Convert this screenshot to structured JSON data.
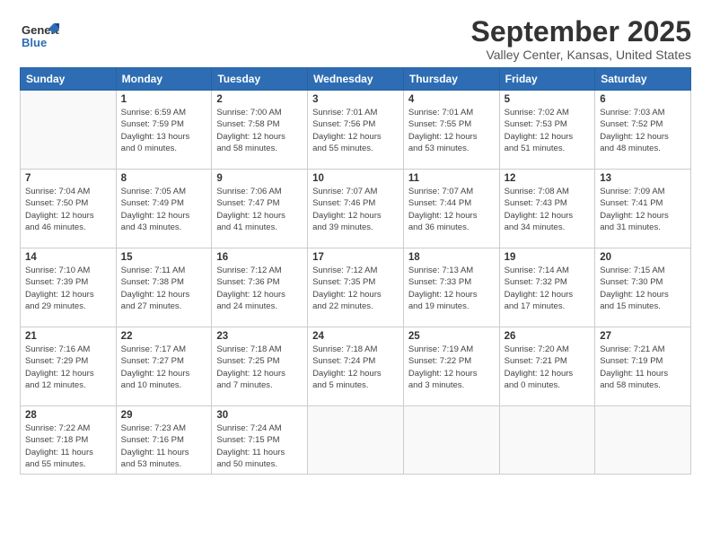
{
  "logo": {
    "general": "General",
    "blue": "Blue"
  },
  "title": "September 2025",
  "subtitle": "Valley Center, Kansas, United States",
  "days_of_week": [
    "Sunday",
    "Monday",
    "Tuesday",
    "Wednesday",
    "Thursday",
    "Friday",
    "Saturday"
  ],
  "weeks": [
    [
      {
        "day": "",
        "info": ""
      },
      {
        "day": "1",
        "info": "Sunrise: 6:59 AM\nSunset: 7:59 PM\nDaylight: 13 hours\nand 0 minutes."
      },
      {
        "day": "2",
        "info": "Sunrise: 7:00 AM\nSunset: 7:58 PM\nDaylight: 12 hours\nand 58 minutes."
      },
      {
        "day": "3",
        "info": "Sunrise: 7:01 AM\nSunset: 7:56 PM\nDaylight: 12 hours\nand 55 minutes."
      },
      {
        "day": "4",
        "info": "Sunrise: 7:01 AM\nSunset: 7:55 PM\nDaylight: 12 hours\nand 53 minutes."
      },
      {
        "day": "5",
        "info": "Sunrise: 7:02 AM\nSunset: 7:53 PM\nDaylight: 12 hours\nand 51 minutes."
      },
      {
        "day": "6",
        "info": "Sunrise: 7:03 AM\nSunset: 7:52 PM\nDaylight: 12 hours\nand 48 minutes."
      }
    ],
    [
      {
        "day": "7",
        "info": "Sunrise: 7:04 AM\nSunset: 7:50 PM\nDaylight: 12 hours\nand 46 minutes."
      },
      {
        "day": "8",
        "info": "Sunrise: 7:05 AM\nSunset: 7:49 PM\nDaylight: 12 hours\nand 43 minutes."
      },
      {
        "day": "9",
        "info": "Sunrise: 7:06 AM\nSunset: 7:47 PM\nDaylight: 12 hours\nand 41 minutes."
      },
      {
        "day": "10",
        "info": "Sunrise: 7:07 AM\nSunset: 7:46 PM\nDaylight: 12 hours\nand 39 minutes."
      },
      {
        "day": "11",
        "info": "Sunrise: 7:07 AM\nSunset: 7:44 PM\nDaylight: 12 hours\nand 36 minutes."
      },
      {
        "day": "12",
        "info": "Sunrise: 7:08 AM\nSunset: 7:43 PM\nDaylight: 12 hours\nand 34 minutes."
      },
      {
        "day": "13",
        "info": "Sunrise: 7:09 AM\nSunset: 7:41 PM\nDaylight: 12 hours\nand 31 minutes."
      }
    ],
    [
      {
        "day": "14",
        "info": "Sunrise: 7:10 AM\nSunset: 7:39 PM\nDaylight: 12 hours\nand 29 minutes."
      },
      {
        "day": "15",
        "info": "Sunrise: 7:11 AM\nSunset: 7:38 PM\nDaylight: 12 hours\nand 27 minutes."
      },
      {
        "day": "16",
        "info": "Sunrise: 7:12 AM\nSunset: 7:36 PM\nDaylight: 12 hours\nand 24 minutes."
      },
      {
        "day": "17",
        "info": "Sunrise: 7:12 AM\nSunset: 7:35 PM\nDaylight: 12 hours\nand 22 minutes."
      },
      {
        "day": "18",
        "info": "Sunrise: 7:13 AM\nSunset: 7:33 PM\nDaylight: 12 hours\nand 19 minutes."
      },
      {
        "day": "19",
        "info": "Sunrise: 7:14 AM\nSunset: 7:32 PM\nDaylight: 12 hours\nand 17 minutes."
      },
      {
        "day": "20",
        "info": "Sunrise: 7:15 AM\nSunset: 7:30 PM\nDaylight: 12 hours\nand 15 minutes."
      }
    ],
    [
      {
        "day": "21",
        "info": "Sunrise: 7:16 AM\nSunset: 7:29 PM\nDaylight: 12 hours\nand 12 minutes."
      },
      {
        "day": "22",
        "info": "Sunrise: 7:17 AM\nSunset: 7:27 PM\nDaylight: 12 hours\nand 10 minutes."
      },
      {
        "day": "23",
        "info": "Sunrise: 7:18 AM\nSunset: 7:25 PM\nDaylight: 12 hours\nand 7 minutes."
      },
      {
        "day": "24",
        "info": "Sunrise: 7:18 AM\nSunset: 7:24 PM\nDaylight: 12 hours\nand 5 minutes."
      },
      {
        "day": "25",
        "info": "Sunrise: 7:19 AM\nSunset: 7:22 PM\nDaylight: 12 hours\nand 3 minutes."
      },
      {
        "day": "26",
        "info": "Sunrise: 7:20 AM\nSunset: 7:21 PM\nDaylight: 12 hours\nand 0 minutes."
      },
      {
        "day": "27",
        "info": "Sunrise: 7:21 AM\nSunset: 7:19 PM\nDaylight: 11 hours\nand 58 minutes."
      }
    ],
    [
      {
        "day": "28",
        "info": "Sunrise: 7:22 AM\nSunset: 7:18 PM\nDaylight: 11 hours\nand 55 minutes."
      },
      {
        "day": "29",
        "info": "Sunrise: 7:23 AM\nSunset: 7:16 PM\nDaylight: 11 hours\nand 53 minutes."
      },
      {
        "day": "30",
        "info": "Sunrise: 7:24 AM\nSunset: 7:15 PM\nDaylight: 11 hours\nand 50 minutes."
      },
      {
        "day": "",
        "info": ""
      },
      {
        "day": "",
        "info": ""
      },
      {
        "day": "",
        "info": ""
      },
      {
        "day": "",
        "info": ""
      }
    ]
  ]
}
